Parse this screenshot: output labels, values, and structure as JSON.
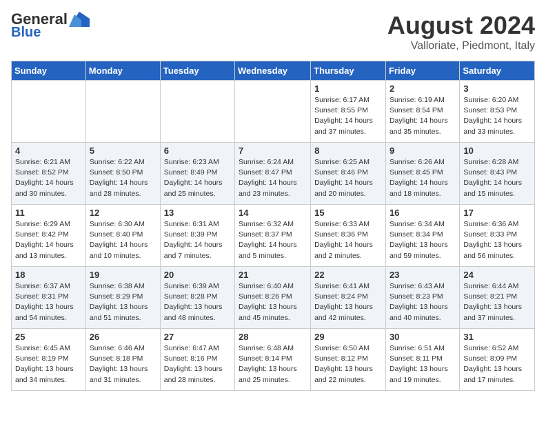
{
  "header": {
    "logo_line1": "General",
    "logo_line2": "Blue",
    "month_year": "August 2024",
    "location": "Valloriate, Piedmont, Italy"
  },
  "days_of_week": [
    "Sunday",
    "Monday",
    "Tuesday",
    "Wednesday",
    "Thursday",
    "Friday",
    "Saturday"
  ],
  "weeks": [
    [
      {
        "day": "",
        "info": ""
      },
      {
        "day": "",
        "info": ""
      },
      {
        "day": "",
        "info": ""
      },
      {
        "day": "",
        "info": ""
      },
      {
        "day": "1",
        "info": "Sunrise: 6:17 AM\nSunset: 8:55 PM\nDaylight: 14 hours and 37 minutes."
      },
      {
        "day": "2",
        "info": "Sunrise: 6:19 AM\nSunset: 8:54 PM\nDaylight: 14 hours and 35 minutes."
      },
      {
        "day": "3",
        "info": "Sunrise: 6:20 AM\nSunset: 8:53 PM\nDaylight: 14 hours and 33 minutes."
      }
    ],
    [
      {
        "day": "4",
        "info": "Sunrise: 6:21 AM\nSunset: 8:52 PM\nDaylight: 14 hours and 30 minutes."
      },
      {
        "day": "5",
        "info": "Sunrise: 6:22 AM\nSunset: 8:50 PM\nDaylight: 14 hours and 28 minutes."
      },
      {
        "day": "6",
        "info": "Sunrise: 6:23 AM\nSunset: 8:49 PM\nDaylight: 14 hours and 25 minutes."
      },
      {
        "day": "7",
        "info": "Sunrise: 6:24 AM\nSunset: 8:47 PM\nDaylight: 14 hours and 23 minutes."
      },
      {
        "day": "8",
        "info": "Sunrise: 6:25 AM\nSunset: 8:46 PM\nDaylight: 14 hours and 20 minutes."
      },
      {
        "day": "9",
        "info": "Sunrise: 6:26 AM\nSunset: 8:45 PM\nDaylight: 14 hours and 18 minutes."
      },
      {
        "day": "10",
        "info": "Sunrise: 6:28 AM\nSunset: 8:43 PM\nDaylight: 14 hours and 15 minutes."
      }
    ],
    [
      {
        "day": "11",
        "info": "Sunrise: 6:29 AM\nSunset: 8:42 PM\nDaylight: 14 hours and 13 minutes."
      },
      {
        "day": "12",
        "info": "Sunrise: 6:30 AM\nSunset: 8:40 PM\nDaylight: 14 hours and 10 minutes."
      },
      {
        "day": "13",
        "info": "Sunrise: 6:31 AM\nSunset: 8:39 PM\nDaylight: 14 hours and 7 minutes."
      },
      {
        "day": "14",
        "info": "Sunrise: 6:32 AM\nSunset: 8:37 PM\nDaylight: 14 hours and 5 minutes."
      },
      {
        "day": "15",
        "info": "Sunrise: 6:33 AM\nSunset: 8:36 PM\nDaylight: 14 hours and 2 minutes."
      },
      {
        "day": "16",
        "info": "Sunrise: 6:34 AM\nSunset: 8:34 PM\nDaylight: 13 hours and 59 minutes."
      },
      {
        "day": "17",
        "info": "Sunrise: 6:36 AM\nSunset: 8:33 PM\nDaylight: 13 hours and 56 minutes."
      }
    ],
    [
      {
        "day": "18",
        "info": "Sunrise: 6:37 AM\nSunset: 8:31 PM\nDaylight: 13 hours and 54 minutes."
      },
      {
        "day": "19",
        "info": "Sunrise: 6:38 AM\nSunset: 8:29 PM\nDaylight: 13 hours and 51 minutes."
      },
      {
        "day": "20",
        "info": "Sunrise: 6:39 AM\nSunset: 8:28 PM\nDaylight: 13 hours and 48 minutes."
      },
      {
        "day": "21",
        "info": "Sunrise: 6:40 AM\nSunset: 8:26 PM\nDaylight: 13 hours and 45 minutes."
      },
      {
        "day": "22",
        "info": "Sunrise: 6:41 AM\nSunset: 8:24 PM\nDaylight: 13 hours and 42 minutes."
      },
      {
        "day": "23",
        "info": "Sunrise: 6:43 AM\nSunset: 8:23 PM\nDaylight: 13 hours and 40 minutes."
      },
      {
        "day": "24",
        "info": "Sunrise: 6:44 AM\nSunset: 8:21 PM\nDaylight: 13 hours and 37 minutes."
      }
    ],
    [
      {
        "day": "25",
        "info": "Sunrise: 6:45 AM\nSunset: 8:19 PM\nDaylight: 13 hours and 34 minutes."
      },
      {
        "day": "26",
        "info": "Sunrise: 6:46 AM\nSunset: 8:18 PM\nDaylight: 13 hours and 31 minutes."
      },
      {
        "day": "27",
        "info": "Sunrise: 6:47 AM\nSunset: 8:16 PM\nDaylight: 13 hours and 28 minutes."
      },
      {
        "day": "28",
        "info": "Sunrise: 6:48 AM\nSunset: 8:14 PM\nDaylight: 13 hours and 25 minutes."
      },
      {
        "day": "29",
        "info": "Sunrise: 6:50 AM\nSunset: 8:12 PM\nDaylight: 13 hours and 22 minutes."
      },
      {
        "day": "30",
        "info": "Sunrise: 6:51 AM\nSunset: 8:11 PM\nDaylight: 13 hours and 19 minutes."
      },
      {
        "day": "31",
        "info": "Sunrise: 6:52 AM\nSunset: 8:09 PM\nDaylight: 13 hours and 17 minutes."
      }
    ]
  ]
}
